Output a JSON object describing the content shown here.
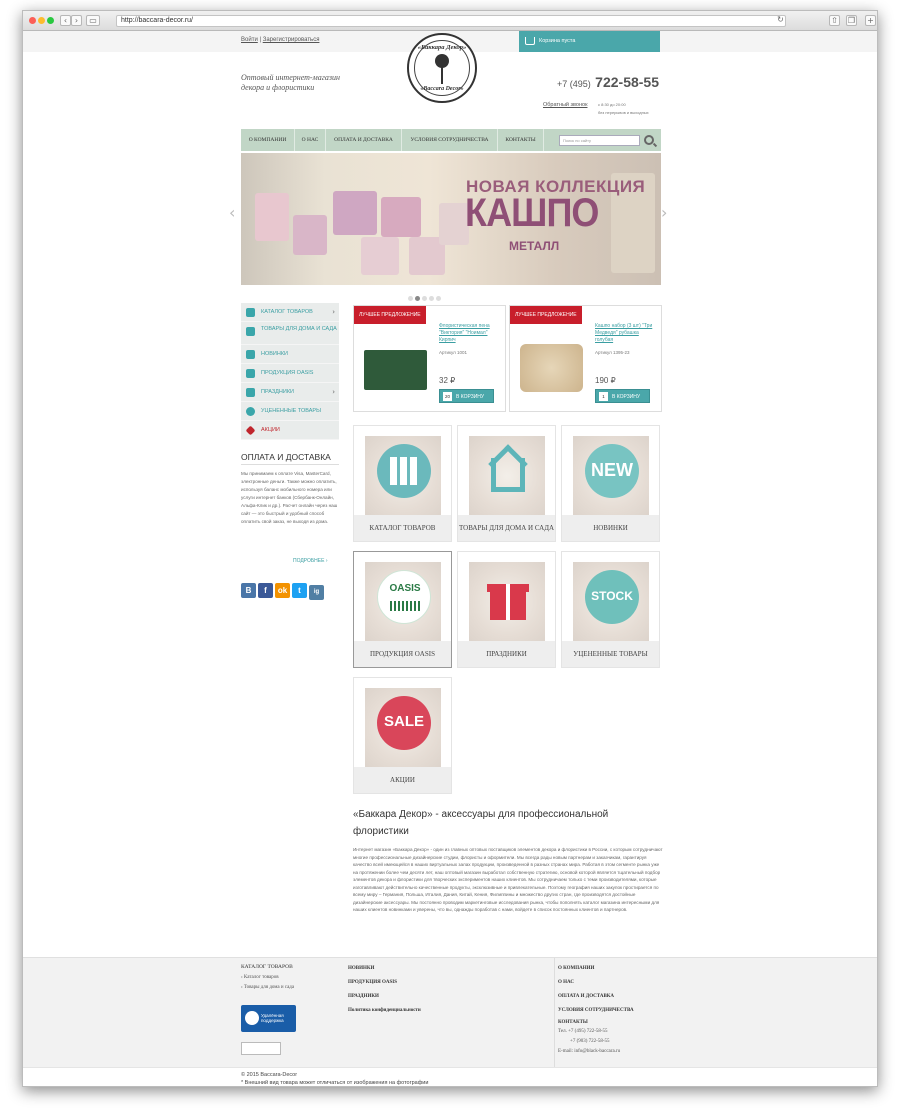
{
  "browser": {
    "url": "http://baccara-decor.ru/"
  },
  "header": {
    "login": "Войти",
    "separator": "|",
    "register": "Зарегистрироваться",
    "cart_label": "Корзина пуста",
    "logo_top": "«Баккара Декор»",
    "logo_bottom": "«Baccara Decor»",
    "tagline_1": "Оптовый интернет-магазин",
    "tagline_2": "декора и флористики",
    "phone_prefix": "+7 (495)",
    "phone_number": "722-58-55",
    "callback": "Обратный звонок",
    "hours_1": "с 8:30 до 20:00",
    "hours_2": "без перерывов и выходных"
  },
  "nav": {
    "items": [
      "О КОМПАНИИ",
      "О НАС",
      "ОПЛАТА И ДОСТАВКА",
      "УСЛОВИЯ СОТРУДНИЧЕСТВА",
      "КОНТАКТЫ"
    ],
    "search_placeholder": "Поиск по сайту"
  },
  "banner": {
    "line1": "НОВАЯ КОЛЛЕКЦИЯ",
    "line2": "КАШПО",
    "line3": "МЕТАЛЛ",
    "slides": 5,
    "active_slide": 2
  },
  "sidebar": {
    "items": [
      {
        "label": "КАТАЛОГ ТОВАРОВ",
        "has_arrow": true
      },
      {
        "label": "ТОВАРЫ ДЛЯ ДОМА И САДА",
        "has_arrow": false
      },
      {
        "label": "НОВИНКИ",
        "has_arrow": false
      },
      {
        "label": "ПРОДУКЦИЯ OASIS",
        "has_arrow": false
      },
      {
        "label": "ПРАЗДНИКИ",
        "has_arrow": true
      },
      {
        "label": "УЦЕНЕННЫЕ ТОВАРЫ",
        "has_arrow": false
      },
      {
        "label": "АКЦИИ",
        "has_arrow": false
      }
    ],
    "payment_title": "ОПЛАТА И ДОСТАВКА",
    "payment_text": "Мы принимаем к оплате Visa, MasterCard, электронные деньги. Также можно оплатить, используя баланс мобильного номера или услуги интернет банков (Сбербанк-Онлайн, Альфа-Клик и др.). Расчет онлайн через наш сайт — это быстрый и удобный способ оплатить свой заказ, не выходя из дома.",
    "more": "ПОДРОБНЕЕ",
    "social": [
      "В",
      "f",
      "ok",
      "t",
      "ig"
    ]
  },
  "offers": [
    {
      "badge": "ЛУЧШЕЕ ПРЕДЛОЖЕНИЕ",
      "name": "Флористическая пена \"Виктория\" \"Ноимал\" Кирпич",
      "article": "Артикул 1001",
      "price": "32 ₽",
      "qty": "20",
      "button": "В КОРЗИНУ"
    },
    {
      "badge": "ЛУЧШЕЕ ПРЕДЛОЖЕНИЕ",
      "name": "Кашпо набор (3 шт) \"Три Медведя\" рубашка голубая",
      "article": "Артикул 1395-23",
      "price": "190 ₽",
      "qty": "1",
      "button": "В КОРЗИНУ"
    }
  ],
  "tiles": [
    {
      "label": "КАТАЛОГ ТОВАРОВ",
      "icon": "folders-icon"
    },
    {
      "label": "ТОВАРЫ ДЛЯ ДОМА И САДА",
      "icon": "house-icon"
    },
    {
      "label": "НОВИНКИ",
      "icon": "new-icon",
      "circle_text": "NEW"
    },
    {
      "label": "ПРОДУКЦИЯ OASIS",
      "icon": "oasis-icon",
      "circle_text": "OASIS"
    },
    {
      "label": "ПРАЗДНИКИ",
      "icon": "gift-icon"
    },
    {
      "label": "УЦЕНЕННЫЕ ТОВАРЫ",
      "icon": "stock-icon",
      "circle_text": "STOCK"
    },
    {
      "label": "АКЦИИ",
      "icon": "sale-icon",
      "circle_text": "SALE"
    }
  ],
  "about": {
    "title": "«Баккара Декор» - аксессуары для профессиональной флористики",
    "text": "Интернет магазин «Баккара Декор» - один из главных оптовых поставщиков элементов декора и флористики в России, с которым сотрудничают многие профессиональные дизайнерские студии, флористы и оформители. Мы всегда рады новым партнерам и заказчикам, гарантируя качество всей имеющейся в наших виртуальных залах продукции, произведенной в разных странах мира. Работая в этом сегменте рынка уже на протяжении более чем десяти лет, наш оптовый магазин выработал собственную стратегию, основой которой является тщательный подбор элементов декора и флористики для творческих экспериментов наших клиентов. Мы сотрудничаем только с теми производителями, которые изготавливают действительно качественные продукты, эксклюзивные и привлекательные. Поэтому география наших закупок простирается по всему миру – Германия, Польша, Италия, Дания, Китай, Кения, Филиппины и множество других стран, где производятся достойные дизайнерские аксессуары. Мы постоянно проводим маркетинговые исследования рынка, чтобы пополнять каталог магазина интересными для наших клиентов новинками и уверены, что вы, однажды поработав с нами, войдете в список постоянных клиентов и партнеров."
  },
  "footer": {
    "col1_title": "КАТАЛОГ ТОВАРОВ",
    "col1_links": [
      "Каталог товаров",
      "Товары для дома и сада"
    ],
    "col2_links": [
      "НОВИНКИ",
      "ПРОДУКЦИЯ OASIS",
      "ПРАЗДНИКИ",
      "Политика конфиденциальности"
    ],
    "col3_links": [
      "О КОМПАНИИ",
      "О НАС",
      "ОПЛАТА И ДОСТАВКА",
      "УСЛОВИЯ СОТРУДНИЧЕСТВА",
      "КОНТАКТЫ"
    ],
    "contacts_phone_label": "Тел.",
    "contacts_phone_1": "+7 (495) 722-58-55",
    "contacts_phone_2": "+7 (903) 722-58-55",
    "contacts_email": "E-mail: info@black-baccara.ru",
    "teamviewer_1": "Удалённая",
    "teamviewer_2": "поддержка",
    "copyright": "© 2015 Baccara-Decor",
    "note": "* Внешний вид товара может отличаться от изображения на фотографии"
  }
}
